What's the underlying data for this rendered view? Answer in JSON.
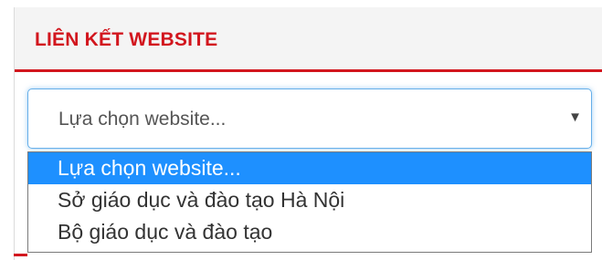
{
  "widget": {
    "title": "LIÊN KẾT WEBSITE"
  },
  "select": {
    "current_value": "Lựa chọn website...",
    "arrow_icon": "triangle-down-icon"
  },
  "dropdown": {
    "options": [
      {
        "label": "Lựa chọn website...",
        "selected": true
      },
      {
        "label": "Sở giáo dục và đào tạo Hà Nội",
        "selected": false
      },
      {
        "label": "Bộ giáo dục và đào tạo",
        "selected": false
      }
    ]
  },
  "colors": {
    "accent_red": "#d2161e",
    "highlight_blue": "#1e90ff",
    "focus_border": "#66afe9"
  }
}
